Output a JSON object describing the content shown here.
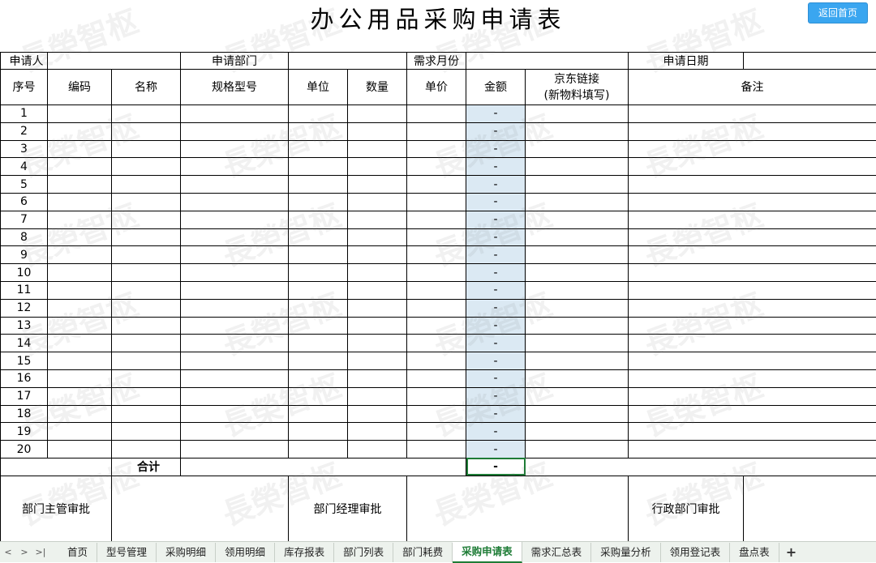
{
  "title": "办公用品采购申请表",
  "home_button": "返回首页",
  "watermark_text": "長榮智枢",
  "info_row": {
    "applicant_label": "申请人",
    "dept_label": "申请部门",
    "month_label": "需求月份",
    "date_label": "申请日期"
  },
  "headers": {
    "seq": "序号",
    "code": "编码",
    "name": "名称",
    "spec": "规格型号",
    "unit": "单位",
    "qty": "数量",
    "price": "单价",
    "amount": "金额",
    "jd_link_line1": "京东链接",
    "jd_link_line2": "(新物料填写)",
    "remark": "备注"
  },
  "rows": [
    {
      "seq": "1",
      "amount": "-"
    },
    {
      "seq": "2",
      "amount": "-"
    },
    {
      "seq": "3",
      "amount": "-"
    },
    {
      "seq": "4",
      "amount": "-"
    },
    {
      "seq": "5",
      "amount": "-"
    },
    {
      "seq": "6",
      "amount": "-"
    },
    {
      "seq": "7",
      "amount": "-"
    },
    {
      "seq": "8",
      "amount": "-"
    },
    {
      "seq": "9",
      "amount": "-"
    },
    {
      "seq": "10",
      "amount": "-"
    },
    {
      "seq": "11",
      "amount": "-"
    },
    {
      "seq": "12",
      "amount": "-"
    },
    {
      "seq": "13",
      "amount": "-"
    },
    {
      "seq": "14",
      "amount": "-"
    },
    {
      "seq": "15",
      "amount": "-"
    },
    {
      "seq": "16",
      "amount": "-"
    },
    {
      "seq": "17",
      "amount": "-"
    },
    {
      "seq": "18",
      "amount": "-"
    },
    {
      "seq": "19",
      "amount": "-"
    },
    {
      "seq": "20",
      "amount": "-"
    }
  ],
  "total": {
    "label": "合计",
    "amount": "-"
  },
  "approvals": {
    "dept_head": "部门主管审批",
    "dept_manager": "部门经理审批",
    "admin_dept": "行政部门审批"
  },
  "tab_nav": {
    "prev": "<",
    "next": ">",
    "last": ">|"
  },
  "tabs": [
    {
      "label": "首页",
      "active": false
    },
    {
      "label": "型号管理",
      "active": false
    },
    {
      "label": "采购明细",
      "active": false
    },
    {
      "label": "领用明细",
      "active": false
    },
    {
      "label": "库存报表",
      "active": false
    },
    {
      "label": "部门列表",
      "active": false
    },
    {
      "label": "部门耗费",
      "active": false
    },
    {
      "label": "采购申请表",
      "active": true
    },
    {
      "label": "需求汇总表",
      "active": false
    },
    {
      "label": "采购量分析",
      "active": false
    },
    {
      "label": "领用登记表",
      "active": false
    },
    {
      "label": "盘点表",
      "active": false
    }
  ],
  "add_tab": "+"
}
